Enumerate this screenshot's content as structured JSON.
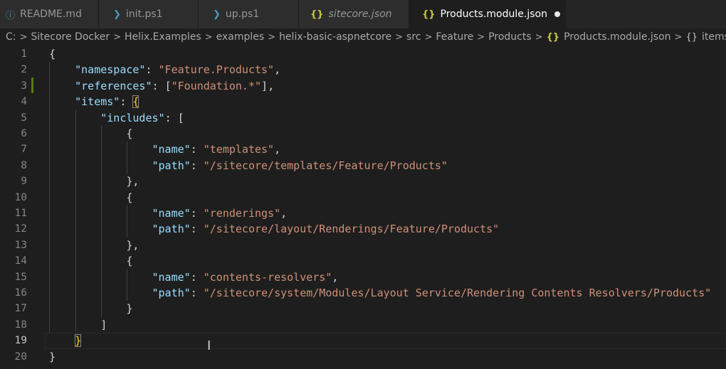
{
  "tabs": [
    {
      "label": "README.md",
      "icon": "info-icon",
      "icon_glyph": "ⓘ",
      "icon_color": "#519aba"
    },
    {
      "label": "init.ps1",
      "icon": "powershell-icon",
      "icon_glyph": "❯",
      "icon_color": "#519aba"
    },
    {
      "label": "up.ps1",
      "icon": "powershell-icon",
      "icon_glyph": "❯",
      "icon_color": "#519aba"
    },
    {
      "label": "sitecore.json",
      "icon": "json-icon",
      "icon_glyph": "{}",
      "icon_color": "#cbcb41"
    },
    {
      "label": "Products.module.json",
      "icon": "json-icon",
      "icon_glyph": "{}",
      "icon_color": "#cbcb41",
      "active": true,
      "dirty": true
    }
  ],
  "breadcrumb": {
    "items": [
      "C:",
      "Sitecore Docker",
      "Helix.Examples",
      "examples",
      "helix-basic-aspnetcore",
      "src",
      "Feature",
      "Products",
      "Products.module.json",
      "items"
    ],
    "separator": ">",
    "json_glyph": "{}",
    "braces_glyph": "{}"
  },
  "editor": {
    "current_line": 19,
    "modified_line": 3,
    "line_numbers": [
      "1",
      "2",
      "3",
      "4",
      "5",
      "6",
      "7",
      "8",
      "9",
      "10",
      "11",
      "12",
      "13",
      "14",
      "15",
      "16",
      "17",
      "18",
      "19",
      "20"
    ],
    "tokens": {
      "open_brace": "{",
      "close_brace": "}",
      "open_bracket": "[",
      "close_bracket": "]",
      "namespace_key": "\"namespace\"",
      "namespace_val": "\"Feature.Products\"",
      "references_key": "\"references\"",
      "references_val": "\"Foundation.*\"",
      "items_key": "\"items\"",
      "includes_key": "\"includes\"",
      "name_key": "\"name\"",
      "path_key": "\"path\"",
      "colon": ": ",
      "comma": ",",
      "close_brace_comma": "},",
      "item1_name": "\"templates\"",
      "item1_path": "\"/sitecore/templates/Feature/Products\"",
      "item2_name": "\"renderings\"",
      "item2_path": "\"/sitecore/layout/Renderings/Feature/Products\"",
      "item3_name": "\"contents-resolvers\"",
      "item3_path": "\"/sitecore/system/Modules/Layout Service/Rendering Contents Resolvers/Products\""
    }
  },
  "colors": {
    "key": "#9cdcfe",
    "string": "#ce9178",
    "punctuation": "#d4d4d4",
    "bracket": "#ffd700",
    "modified_gutter": "#587c0c",
    "editor_bg": "#1e1e1e",
    "tab_bg": "#2d2d2d"
  }
}
